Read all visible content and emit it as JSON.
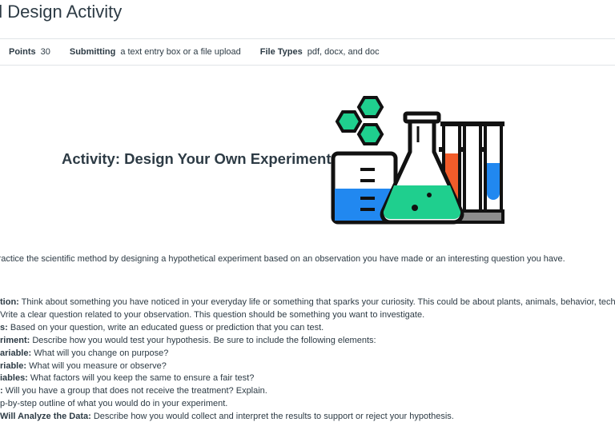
{
  "page": {
    "title": "al Design Activity"
  },
  "meta": {
    "points_label": "Points",
    "points_value": "30",
    "submitting_label": "Submitting",
    "submitting_value": "a text entry box or a file upload",
    "filetypes_label": "File Types",
    "filetypes_value": "pdf, docx, and doc"
  },
  "content": {
    "heading": "Activity: Design Your Own Experiment",
    "illustration": "lab-glassware-icon",
    "intro": "l practice the scientific method by designing a hypothetical experiment based on an observation you have made or an interesting question you have.",
    "steps": [
      {
        "bold": "tion:",
        "text": " Think about something you have noticed in your everyday life or something that sparks your curiosity. This could be about plants, animals, behavior, technology, o"
      },
      {
        "bold": "",
        "text": "Vrite a clear question related to your observation. This question should be something you want to investigate."
      },
      {
        "bold": "s:",
        "text": " Based on your question, write an educated guess or prediction that you can test."
      },
      {
        "bold": "riment:",
        "text": " Describe how you would test your hypothesis. Be sure to include the following elements:"
      },
      {
        "bold": "ariable:",
        "text": " What will you change on purpose?"
      },
      {
        "bold": "riable:",
        "text": " What will you measure or observe?"
      },
      {
        "bold": "iables:",
        "text": " What factors will you keep the same to ensure a fair test?"
      },
      {
        "bold": ":",
        "text": " Will you have a group that does not receive the treatment? Explain."
      },
      {
        "bold": "",
        "text": "p-by-step outline of what you would do in your experiment."
      },
      {
        "bold": "Will Analyze the Data:",
        "text": " Describe how you would collect and interpret the results to support or reject your hypothesis."
      }
    ]
  },
  "colors": {
    "outline": "#111111",
    "green": "#1fcf8e",
    "blue": "#2188f0",
    "orange": "#f25c2a",
    "grey": "#8d8d8d"
  }
}
